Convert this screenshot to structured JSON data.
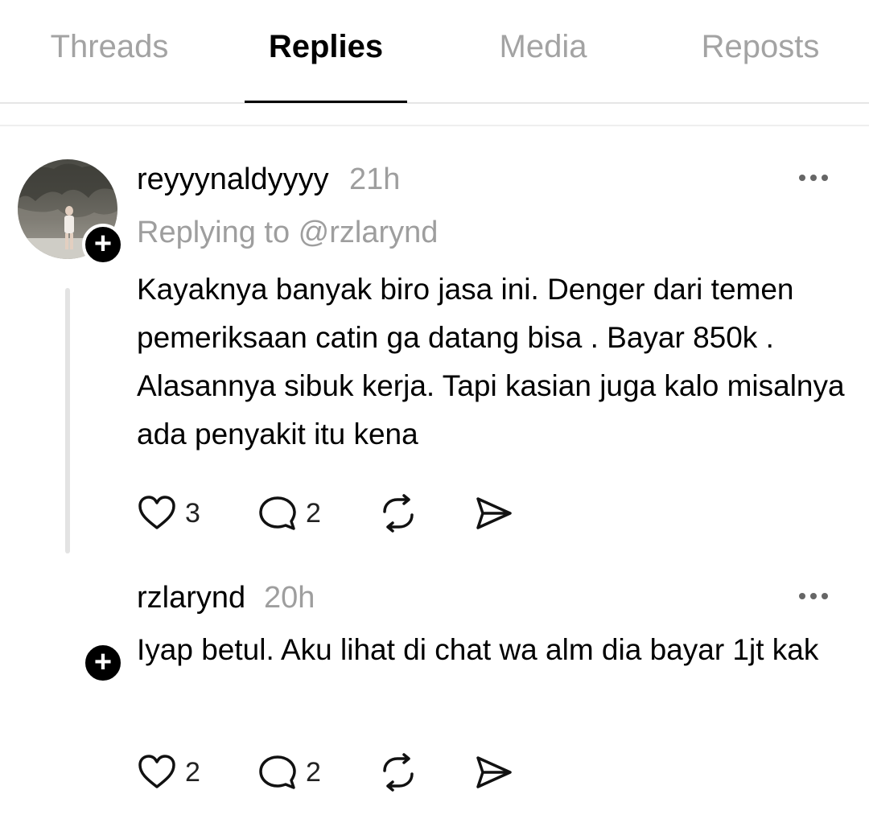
{
  "tabs": [
    {
      "label": "Threads"
    },
    {
      "label": "Replies"
    },
    {
      "label": "Media"
    },
    {
      "label": "Reposts"
    }
  ],
  "posts": [
    {
      "username": "reyyynaldyyyy",
      "time": "21h",
      "replying_to": "Replying to @rzlarynd",
      "text": "Kayaknya banyak biro jasa ini. Denger dari temen pemeriksaan catin ga datang bisa . Bayar 850k . Alasannya sibuk kerja. Tapi kasian juga kalo misalnya ada penyakit itu kena",
      "likes": "3",
      "replies": "2"
    },
    {
      "username": "rzlarynd",
      "time": "20h",
      "text": "Iyap betul. Aku lihat di chat wa alm dia bayar 1jt kak",
      "likes": "2",
      "replies": "2"
    }
  ],
  "icons": {
    "like": "heart-icon",
    "reply": "comment-bubble-icon",
    "repost": "repost-icon",
    "share": "send-icon",
    "more": "more-horizontal-icon",
    "follow": "plus-icon"
  }
}
